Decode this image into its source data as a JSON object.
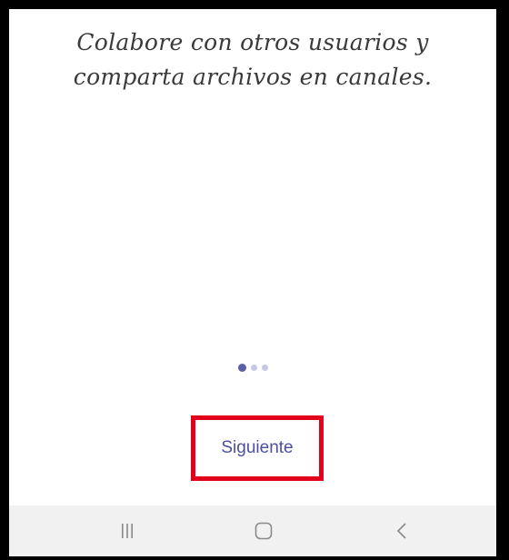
{
  "onboarding": {
    "headline_line1": "Colabore con otros usuarios y",
    "headline_line2": "comparta archivos en canales.",
    "page_indicator": {
      "total_pages": 3,
      "current_page": 1
    },
    "next_button_label": "Siguiente"
  },
  "navbar": {
    "icons": [
      "recent-apps-icon",
      "home-icon",
      "back-icon"
    ]
  },
  "colors": {
    "accent": "#4b4fa0",
    "dot_active": "#5b5fa8",
    "dot_inactive": "#c5c7e4",
    "highlight_border": "#e3001b",
    "navbar_bg": "#f1f1f1"
  }
}
